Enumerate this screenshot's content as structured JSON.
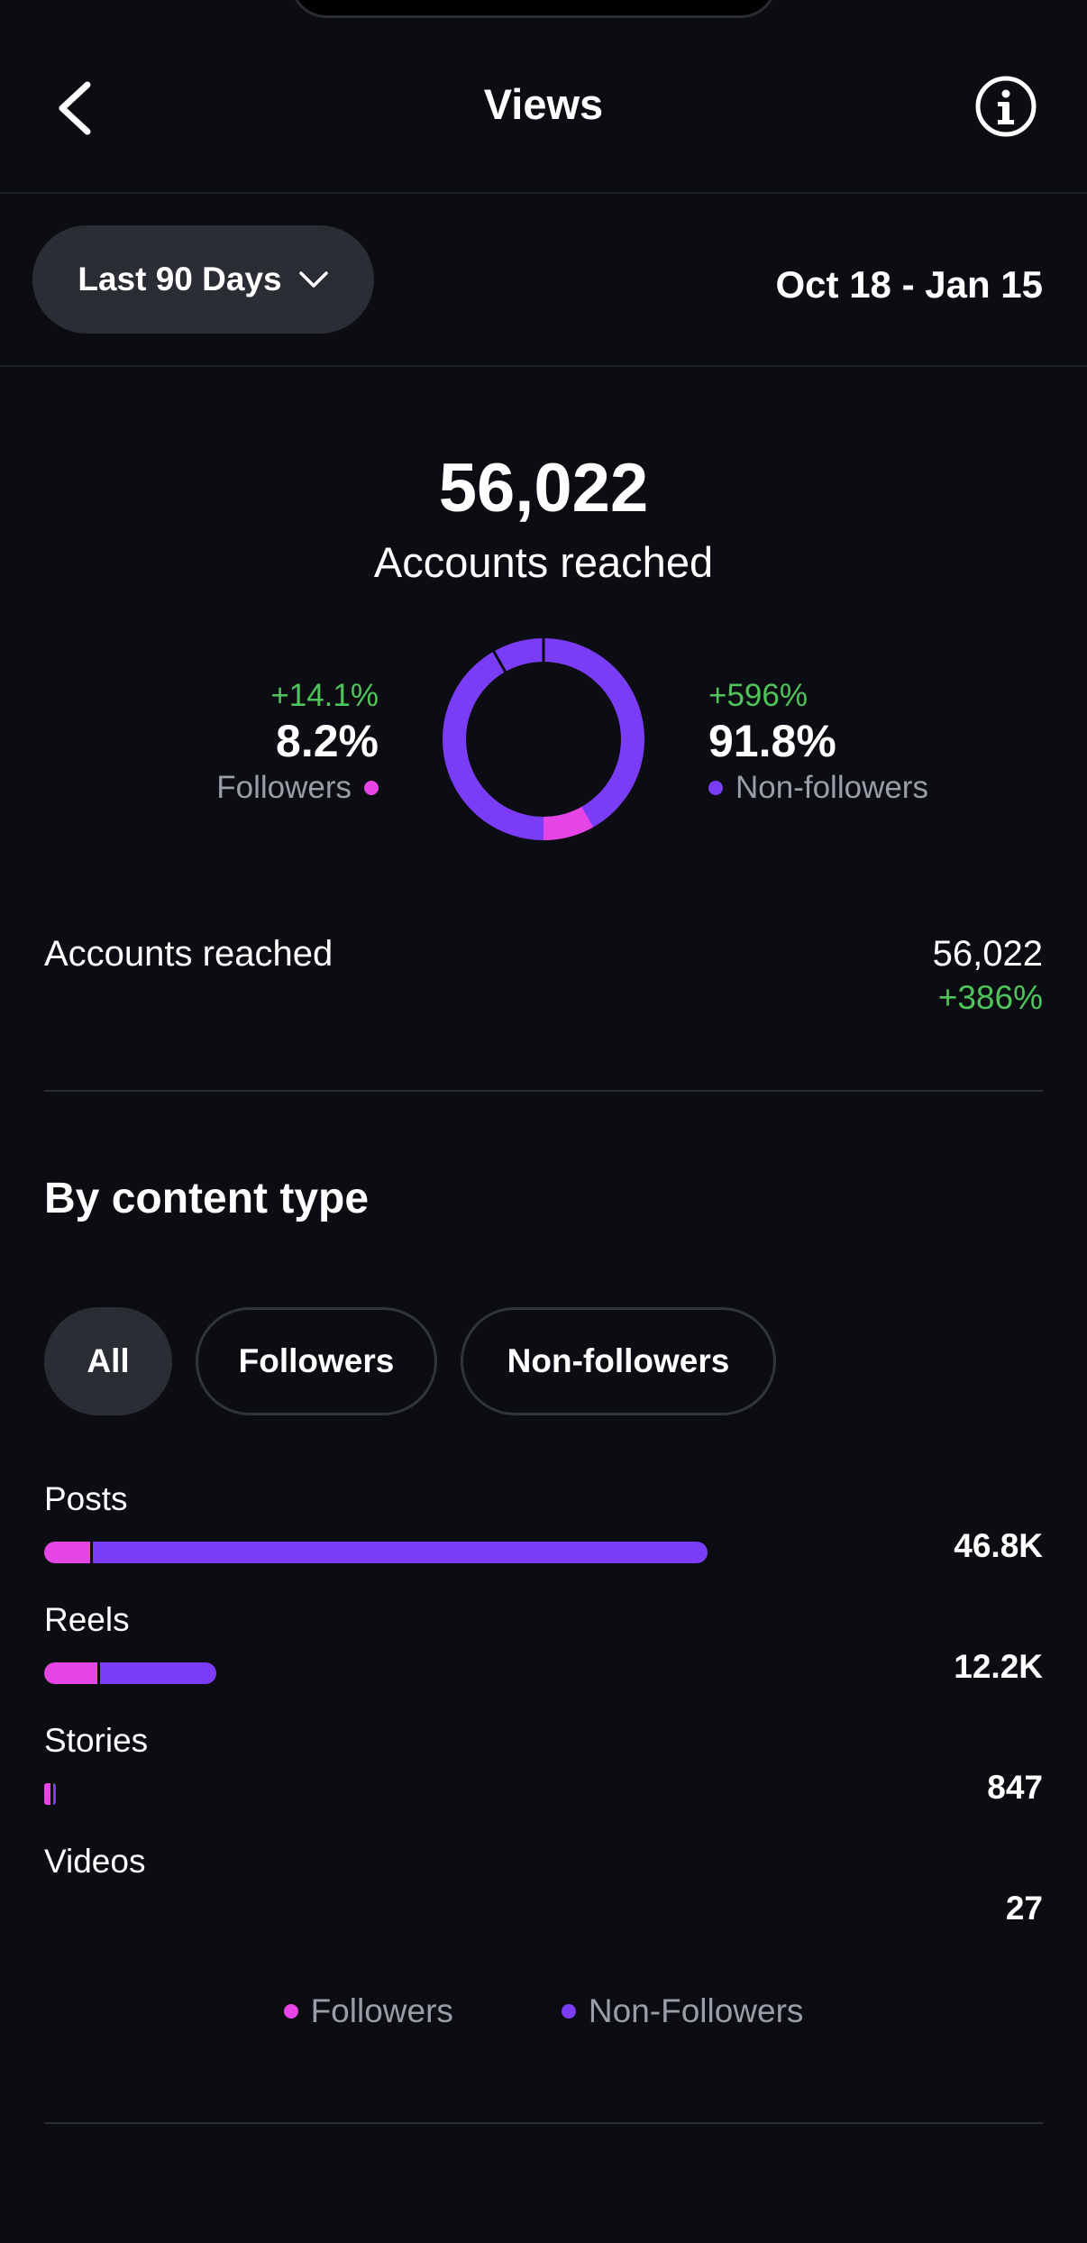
{
  "header": {
    "title": "Views"
  },
  "filter": {
    "range_label": "Last 90 Days",
    "date_range": "Oct 18 - Jan 15"
  },
  "summary": {
    "total": "56,022",
    "label": "Accounts reached",
    "followers": {
      "change": "+14.1%",
      "percent": "8.2%",
      "label": "Followers",
      "fraction": 0.082
    },
    "non_followers": {
      "change": "+596%",
      "percent": "91.8%",
      "label": "Non-followers",
      "fraction": 0.918
    }
  },
  "accounts_row": {
    "label": "Accounts reached",
    "value": "56,022",
    "change": "+386%"
  },
  "content_type": {
    "title": "By content type",
    "chips": [
      {
        "label": "All",
        "active": true
      },
      {
        "label": "Followers",
        "active": false
      },
      {
        "label": "Non-followers",
        "active": false
      }
    ],
    "rows": [
      {
        "label": "Posts",
        "value": "46.8K",
        "followers_share": 0.069,
        "total_share": 1.0
      },
      {
        "label": "Reels",
        "value": "12.2K",
        "followers_share": 0.31,
        "total_share": 0.26
      },
      {
        "label": "Stories",
        "value": "847",
        "followers_share": 0.5,
        "total_share": 0.018
      },
      {
        "label": "Videos",
        "value": "27",
        "followers_share": 0.0,
        "total_share": 0.0
      }
    ],
    "legend": {
      "followers": "Followers",
      "non_followers": "Non-Followers"
    }
  },
  "colors": {
    "followers": "#e744e6",
    "non_followers": "#7b3cf5",
    "positive": "#4fc45a"
  }
}
